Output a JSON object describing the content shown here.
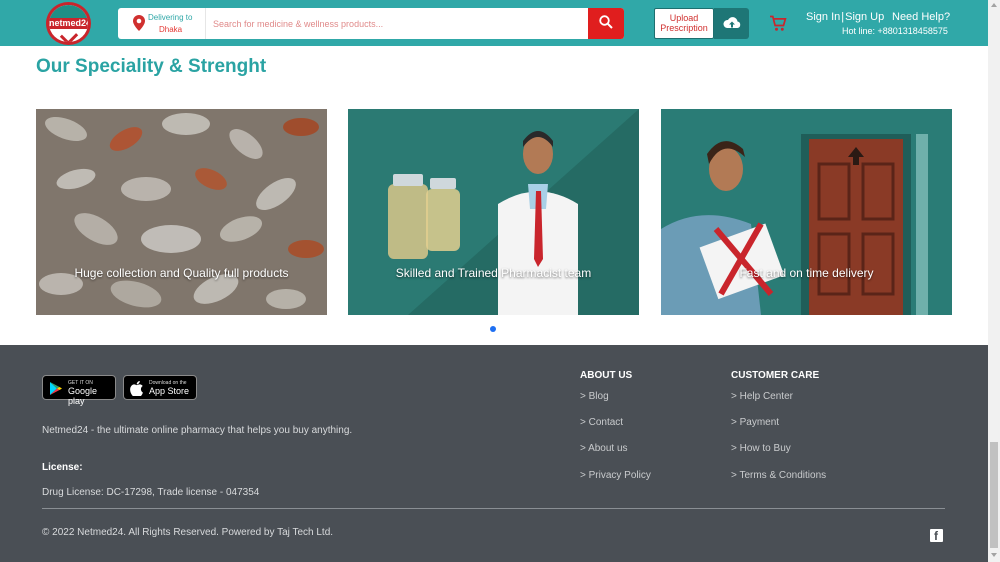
{
  "header": {
    "logo_text": "netmed24",
    "delivering_label": "Delivering to",
    "delivering_city": "Dhaka",
    "search_placeholder": "Search for medicine & wellness products...",
    "upload_label_1": "Upload",
    "upload_label_2": "Prescription",
    "sign_in": "Sign In",
    "separator": "|",
    "sign_up": "Sign Up",
    "need_help": "Need Help?",
    "hotline": "Hot line: +8801318458575",
    "accent_color": "#30a8a8",
    "search_button_color": "#e01e1e"
  },
  "speciality": {
    "title": "Our Speciality & Strenght",
    "cards": [
      {
        "label": "Huge collection and Quality full products",
        "icon": "pills-image"
      },
      {
        "label": "Skilled and Trained Pharmacist team",
        "icon": "pharmacist-image"
      },
      {
        "label": "Fast and on time delivery",
        "icon": "delivery-image"
      }
    ]
  },
  "footer": {
    "google_play_small": "GET IT ON",
    "google_play_big": "Google play",
    "app_store_small": "Download on the",
    "app_store_big": "App Store",
    "tagline": "Netmed24 - the ultimate online pharmacy that helps you buy anything.",
    "license_title": "License:",
    "license_text": "Drug License: DC-17298, Trade license - 047354",
    "about_us": {
      "title": "ABOUT US",
      "links": [
        "> Blog",
        "> Contact",
        "> About us",
        "> Privacy Policy"
      ]
    },
    "customer_care": {
      "title": "CUSTOMER CARE",
      "links": [
        "> Help Center",
        "> Payment",
        "> How to Buy",
        "> Terms & Conditions"
      ]
    },
    "copyright": "© 2022 Netmed24. All Rights Reserved. Powered by Taj Tech Ltd.",
    "background_color": "#4a4f55"
  }
}
